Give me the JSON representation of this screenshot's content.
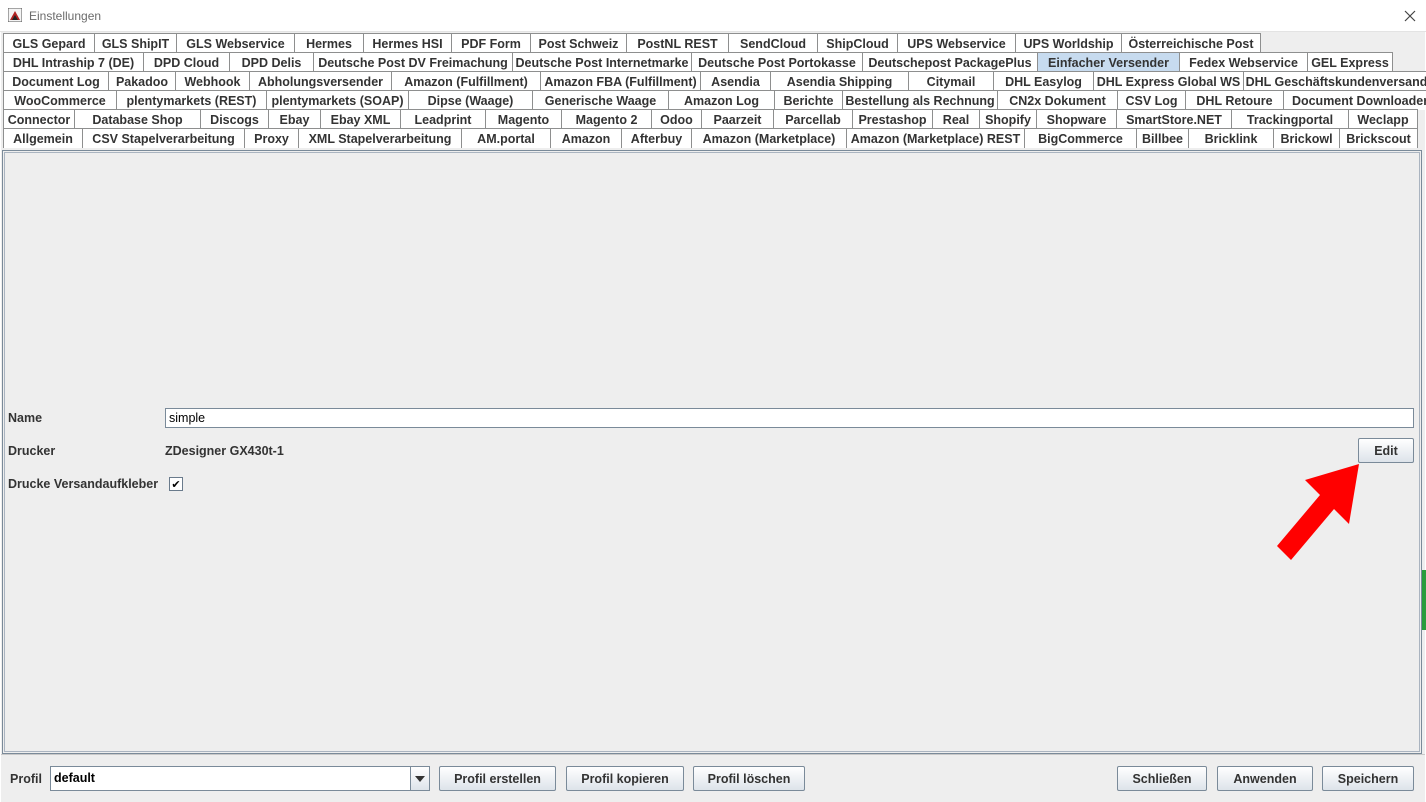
{
  "window": {
    "title": "Einstellungen"
  },
  "tab_rows": [
    [
      "GLS Gepard",
      "GLS ShipIT",
      "GLS Webservice",
      "Hermes",
      "Hermes HSI",
      "PDF Form",
      "Post Schweiz",
      "PostNL REST",
      "SendCloud",
      "ShipCloud",
      "UPS Webservice",
      "UPS Worldship",
      "Österreichische Post"
    ],
    [
      "DHL Intraship 7 (DE)",
      "DPD Cloud",
      "DPD Delis",
      "Deutsche Post DV Freimachung",
      "Deutsche Post Internetmarke",
      "Deutsche Post Portokasse",
      "Deutschepost PackagePlus",
      "Einfacher Versender",
      "Fedex Webservice",
      "GEL Express"
    ],
    [
      "Document Log",
      "Pakadoo",
      "Webhook",
      "Abholungsversender",
      "Amazon (Fulfillment)",
      "Amazon FBA (Fulfillment)",
      "Asendia",
      "Asendia Shipping",
      "Citymail",
      "DHL Easylog",
      "DHL Express Global WS",
      "DHL Geschäftskundenversand"
    ],
    [
      "WooCommerce",
      "plentymarkets (REST)",
      "plentymarkets (SOAP)",
      "Dipse (Waage)",
      "Generische Waage",
      "Amazon Log",
      "Berichte",
      "Bestellung als Rechnung",
      "CN2x Dokument",
      "CSV Log",
      "DHL Retoure",
      "Document Downloader"
    ],
    [
      "Connector",
      "Database Shop",
      "Discogs",
      "Ebay",
      "Ebay XML",
      "Leadprint",
      "Magento",
      "Magento 2",
      "Odoo",
      "Paarzeit",
      "Parcellab",
      "Prestashop",
      "Real",
      "Shopify",
      "Shopware",
      "SmartStore.NET",
      "Trackingportal",
      "Weclapp"
    ],
    [
      "Allgemein",
      "CSV Stapelverarbeitung",
      "Proxy",
      "XML Stapelverarbeitung",
      "AM.portal",
      "Amazon",
      "Afterbuy",
      "Amazon (Marketplace)",
      "Amazon (Marketplace) REST",
      "BigCommerce",
      "Billbee",
      "Bricklink",
      "Brickowl",
      "Brickscout"
    ]
  ],
  "selected_tab": "Einfacher Versender",
  "form": {
    "name_label": "Name",
    "name_value": "simple",
    "printer_label": "Drucker",
    "printer_value": "ZDesigner GX430t-1",
    "edit_button": "Edit",
    "print_label_label": "Drucke Versandaufkleber",
    "print_label_checked": true,
    "checkmark": "✔"
  },
  "footer": {
    "profile_label": "Profil",
    "profile_value": "default",
    "create_profile": "Profil erstellen",
    "copy_profile": "Profil kopieren",
    "delete_profile": "Profil löschen",
    "close": "Schließen",
    "apply": "Anwenden",
    "save": "Speichern"
  },
  "colors": {
    "selected_tab": "#c7dbef",
    "annotation_arrow": "#ff0000",
    "window_bg": "#eeeeee"
  }
}
